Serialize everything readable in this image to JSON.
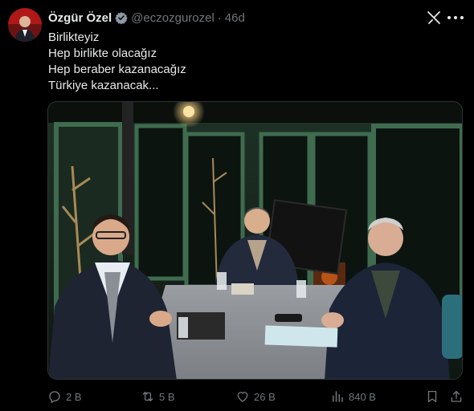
{
  "author": {
    "name": "Özgür Özel",
    "handle": "@eczozgurozel",
    "separator": "·",
    "time": "46d",
    "verified": true
  },
  "icons": {
    "verified": "verified-badge-icon",
    "grok": "grok-icon",
    "more": "more-options-icon",
    "reply": "reply-icon",
    "repost": "repost-icon",
    "like": "heart-icon",
    "views": "views-chart-icon",
    "bookmark": "bookmark-icon",
    "share": "share-icon"
  },
  "tweet": {
    "lines": [
      "Birlikteyiz",
      "Hep birlikte olacağız",
      "Hep beraber kazanacağız",
      "Türkiye kazanacak..."
    ]
  },
  "metrics": {
    "replies": "2 B",
    "reposts": "5 B",
    "likes": "26 B",
    "views": "840 B"
  },
  "colors": {
    "background": "#000000",
    "text": "#e7e9ea",
    "muted": "#71767b",
    "verified": "#8b98a5"
  }
}
